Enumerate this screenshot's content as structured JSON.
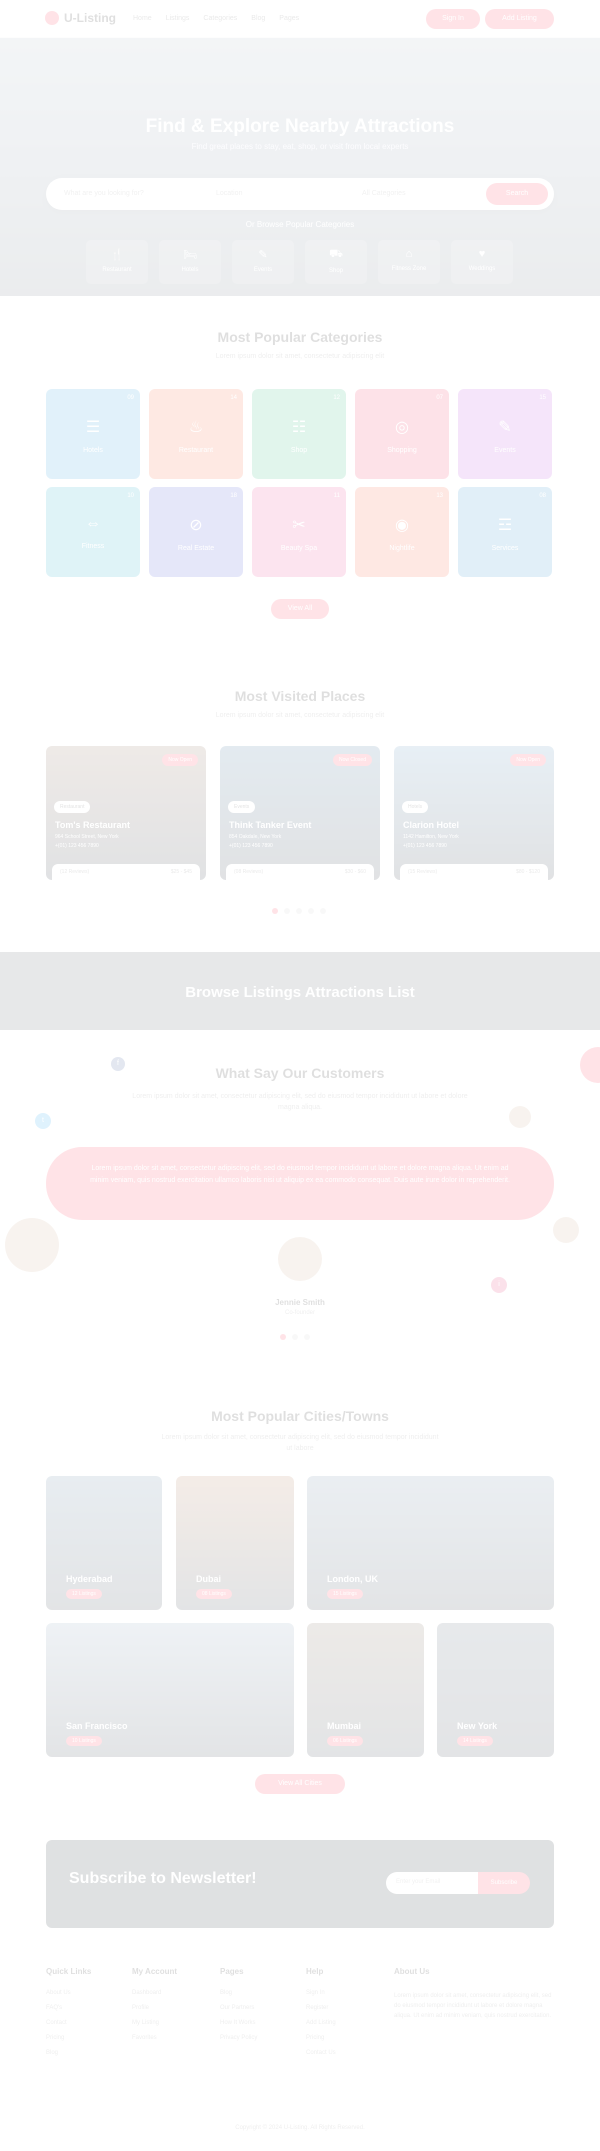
{
  "header": {
    "logo_text": "U-Listing",
    "nav": [
      "Home",
      "Listings",
      "Categories",
      "Blog",
      "Pages"
    ],
    "btn_login": "Sign In",
    "btn_add": "Add Listing"
  },
  "hero": {
    "title": "Find & Explore Nearby Attractions",
    "subtitle": "Find great places to stay, eat, shop, or visit from local experts",
    "search_what": "What are you looking for?",
    "search_where": "Location",
    "search_cat": "All Categories",
    "search_btn": "Search",
    "browse_label": "Or Browse Popular Categories",
    "categories": [
      {
        "label": "Restaurant",
        "icon": "utensils-icon",
        "glyph": "🍴"
      },
      {
        "label": "Hotels",
        "icon": "bed-icon",
        "glyph": "🛏"
      },
      {
        "label": "Events",
        "icon": "calendar-icon",
        "glyph": "✎"
      },
      {
        "label": "Shop",
        "icon": "cart-icon",
        "glyph": "⛟"
      },
      {
        "label": "Fitness Zone",
        "icon": "dumbbell-icon",
        "glyph": "⌂"
      },
      {
        "label": "Weddings",
        "icon": "heart-icon",
        "glyph": "♥"
      }
    ]
  },
  "popular_categories": {
    "title": "Most Popular Categories",
    "subtitle": "Lorem ipsum dolor sit amet, consectetur adipiscing elit",
    "cards": [
      {
        "label": "Hotels",
        "count": "09",
        "icon": "bed-icon",
        "glyph": "☰",
        "color": "#2f9fd8"
      },
      {
        "label": "Restaurant",
        "count": "14",
        "icon": "utensils-icon",
        "glyph": "♨",
        "color": "#f7673a"
      },
      {
        "label": "Shop",
        "count": "12",
        "icon": "cart-icon",
        "glyph": "☷",
        "color": "#2fb67c"
      },
      {
        "label": "Shopping",
        "count": "07",
        "icon": "bag-icon",
        "glyph": "◎",
        "color": "#f2365d"
      },
      {
        "label": "Events",
        "count": "15",
        "icon": "calendar-icon",
        "glyph": "✎",
        "color": "#b547d8"
      },
      {
        "label": "Fitness",
        "count": "10",
        "icon": "dumbbell-icon",
        "glyph": "⇔",
        "color": "#1fa7c7"
      },
      {
        "label": "Real Estate",
        "count": "18",
        "icon": "home-icon",
        "glyph": "⊘",
        "color": "#4c56d6"
      },
      {
        "label": "Beauty Spa",
        "count": "11",
        "icon": "spa-icon",
        "glyph": "✂",
        "color": "#e8418e"
      },
      {
        "label": "Nightlife",
        "count": "13",
        "icon": "music-icon",
        "glyph": "◉",
        "color": "#f65a3c"
      },
      {
        "label": "Services",
        "count": "08",
        "icon": "tools-icon",
        "glyph": "☲",
        "color": "#2c8ec9"
      }
    ],
    "view_all": "View All Categories"
  },
  "visited_places": {
    "title": "Most Visited Places",
    "subtitle": "Lorem ipsum dolor sit amet, consectetur adipiscing elit",
    "places": [
      {
        "tag": "Now Open",
        "badge": "Restaurant",
        "name": "Tom's Restaurant",
        "address": "964 School Street, New York",
        "phone": "+(01) 123 456 7890",
        "reviews": "(12 Reviews)",
        "price": "$25 - $45",
        "color": "#8a6b57"
      },
      {
        "tag": "Now Closed",
        "badge": "Events",
        "name": "Think Tanker Event",
        "address": "854 Oakdale, New York",
        "phone": "+(01) 123 456 7890",
        "reviews": "(08 Reviews)",
        "price": "$30 - $60",
        "color": "#3d6f95"
      },
      {
        "tag": "Now Open",
        "badge": "Hotels",
        "name": "Clarion Hotel",
        "address": "1142 Hamilton, New York",
        "phone": "+(01) 123 456 7890",
        "reviews": "(15 Reviews)",
        "price": "$80 - $120",
        "color": "#5a8fb8"
      }
    ]
  },
  "browse_banner": {
    "title": "Browse Listings Attractions List"
  },
  "testimonials": {
    "title": "What Say Our Customers",
    "subtitle": "Lorem ipsum dolor sit amet, consectetur adipiscing elit, sed do eiusmod tempor incididunt ut labore et dolore magna aliqua.",
    "quote": "Lorem ipsum dolor sit amet, consectetur adipiscing elit, sed do eiusmod tempor incididunt ut labore et dolore magna aliqua. Ut enim ad minim veniam, quis nostrud exercitation ullamco laboris nisi ut aliquip ex ea commodo consequat. Duis aute irure dolor in reprehenderit.",
    "name": "Jennie Smith",
    "role": "Co-founder"
  },
  "cities": {
    "title": "Most Popular Cities/Towns",
    "subtitle": "Lorem ipsum dolor sit amet, consectetur adipiscing elit, sed do eiusmod tempor incididunt ut labore",
    "items": [
      {
        "name": "Hyderabad",
        "count": "12 Listings",
        "color": "#5d7f9c"
      },
      {
        "name": "Dubai",
        "count": "08 Listings",
        "color": "#b07a55"
      },
      {
        "name": "London, UK",
        "count": "15 Listings",
        "color": "#6e8aa3"
      },
      {
        "name": "San Francisco",
        "count": "10 Listings",
        "color": "#8aa2b8"
      },
      {
        "name": "Mumbai",
        "count": "06 Listings",
        "color": "#7d6b5a"
      },
      {
        "name": "New York",
        "count": "14 Listings",
        "color": "#566574"
      }
    ],
    "view_all": "View All Cities"
  },
  "newsletter": {
    "title": "Subscribe to Newsletter!",
    "placeholder": "Enter your Email",
    "button": "Subscribe"
  },
  "footer": {
    "columns": [
      {
        "heading": "Quick Links",
        "links": [
          "About Us",
          "FAQ's",
          "Contact",
          "Pricing",
          "Blog"
        ]
      },
      {
        "heading": "My Account",
        "links": [
          "Dashboard",
          "Profile",
          "My Listing",
          "Favorites"
        ]
      },
      {
        "heading": "Pages",
        "links": [
          "Blog",
          "Our Partners",
          "How It Works",
          "Privacy Policy"
        ]
      },
      {
        "heading": "Help",
        "links": [
          "Sign In",
          "Register",
          "Add Listing",
          "Pricing",
          "Contact Us"
        ]
      }
    ],
    "about_heading": "About Us",
    "about_text": "Lorem ipsum dolor sit amet, consectetur adipiscing elit, sed do eiusmod tempor incididunt ut labore et dolore magna aliqua. Ut enim ad minim veniam, quis nostrud exercitation.",
    "copyright": "Copyright © 2024 U-Listing. All Rights Reserved."
  }
}
